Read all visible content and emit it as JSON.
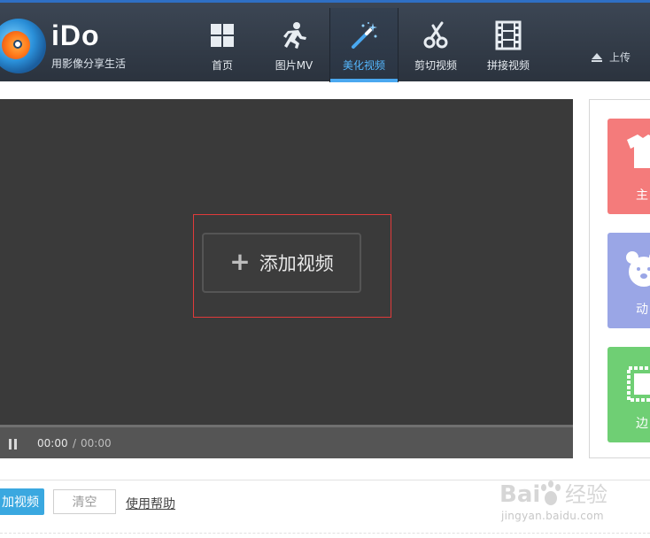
{
  "app": {
    "title": "iDo",
    "slogan": "用影像分享生活"
  },
  "nav": {
    "tabs": [
      {
        "label": "首页",
        "icon": "grid-icon"
      },
      {
        "label": "图片MV",
        "icon": "runner-icon"
      },
      {
        "label": "美化视频",
        "icon": "magic-wand-icon",
        "active": true
      },
      {
        "label": "剪切视频",
        "icon": "scissors-icon"
      },
      {
        "label": "拼接视频",
        "icon": "film-strip-icon"
      }
    ],
    "upload_label": "上传"
  },
  "player": {
    "add_video_label": "添加视频",
    "time_current": "00:00",
    "time_separator": "/",
    "time_total": "00:00"
  },
  "side_panel": {
    "tiles": [
      {
        "label": "主",
        "icon": "tshirt-icon",
        "color": "#f47b7b"
      },
      {
        "label": "动",
        "icon": "bear-icon",
        "color": "#9aa6e6"
      },
      {
        "label": "边",
        "icon": "frame-icon",
        "color": "#6fcf74"
      }
    ]
  },
  "bottom_bar": {
    "add_video_label": "加视频",
    "clear_label": "清空",
    "help_label": "使用帮助"
  },
  "watermark": {
    "text": "Bai 经验",
    "url": "jingyan.baidu.com"
  },
  "colors": {
    "accent": "#4aa8f0",
    "header": "#343d49",
    "highlight": "#e03a3a"
  }
}
